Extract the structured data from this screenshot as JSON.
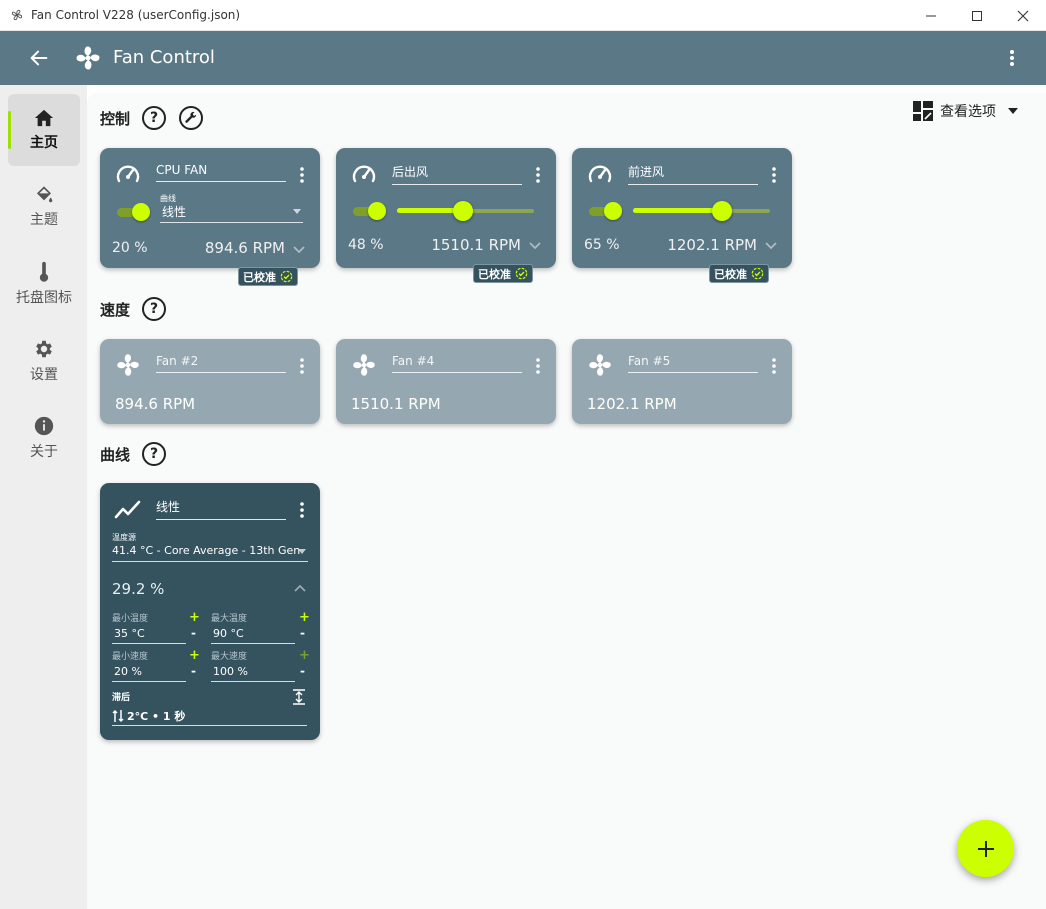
{
  "window": {
    "title": "Fan Control V228 (userConfig.json)",
    "minimize_icon": "minimize-icon",
    "maximize_icon": "maximize-icon",
    "close_icon": "close-icon"
  },
  "appbar": {
    "title": "Fan Control",
    "back_icon": "arrow-left-icon",
    "menu_icon": "more-vertical-icon"
  },
  "sidebar": {
    "items": [
      {
        "label": "主页",
        "icon": "home-icon",
        "active": true
      },
      {
        "label": "主题",
        "icon": "paint-bucket-icon",
        "active": false
      },
      {
        "label": "托盘图标",
        "icon": "thermometer-icon",
        "active": false
      },
      {
        "label": "设置",
        "icon": "gear-icon",
        "active": false
      },
      {
        "label": "关于",
        "icon": "info-icon",
        "active": false
      }
    ]
  },
  "view_options": {
    "label": "查看选项"
  },
  "sections": {
    "control": {
      "title": "控制"
    },
    "speed": {
      "title": "速度"
    },
    "curves": {
      "title": "曲线"
    }
  },
  "colors": {
    "accent": "#ccff00",
    "appbar": "#5b7887",
    "control_card": "#5b7887",
    "speed_card": "#95a8b1",
    "curve_card": "#35525f"
  },
  "controls": [
    {
      "name": "CPU FAN",
      "curve_label": "曲线",
      "curve_value": "线性",
      "percent": "20 %",
      "rpm": "894.6 RPM",
      "badge": "已校准",
      "enabled": true
    },
    {
      "name": "后出风",
      "percent": "48 %",
      "rpm": "1510.1 RPM",
      "badge": "已校准",
      "enabled": true,
      "slider": 0.48
    },
    {
      "name": "前进风",
      "percent": "65 %",
      "rpm": "1202.1 RPM",
      "badge": "已校准",
      "enabled": true,
      "slider": 0.65
    }
  ],
  "speeds": [
    {
      "name": "Fan #2",
      "rpm": "894.6 RPM"
    },
    {
      "name": "Fan #4",
      "rpm": "1510.1 RPM"
    },
    {
      "name": "Fan #5",
      "rpm": "1202.1 RPM"
    }
  ],
  "curve": {
    "name": "线性",
    "source_label": "温度源",
    "source_value": "41.4 °C - Core Average - 13th Gen",
    "output": "29.2 %",
    "min_temp_label": "最小温度",
    "min_temp": "35 °C",
    "max_temp_label": "最大温度",
    "max_temp": "90 °C",
    "min_speed_label": "最小速度",
    "min_speed": "20 %",
    "max_speed_label": "最大速度",
    "max_speed": "100 %",
    "hysteresis_label": "滞后",
    "hysteresis_value": "2°C • 1 秒",
    "plus": "+",
    "minus": "-"
  },
  "fab": {
    "icon": "plus-icon"
  }
}
